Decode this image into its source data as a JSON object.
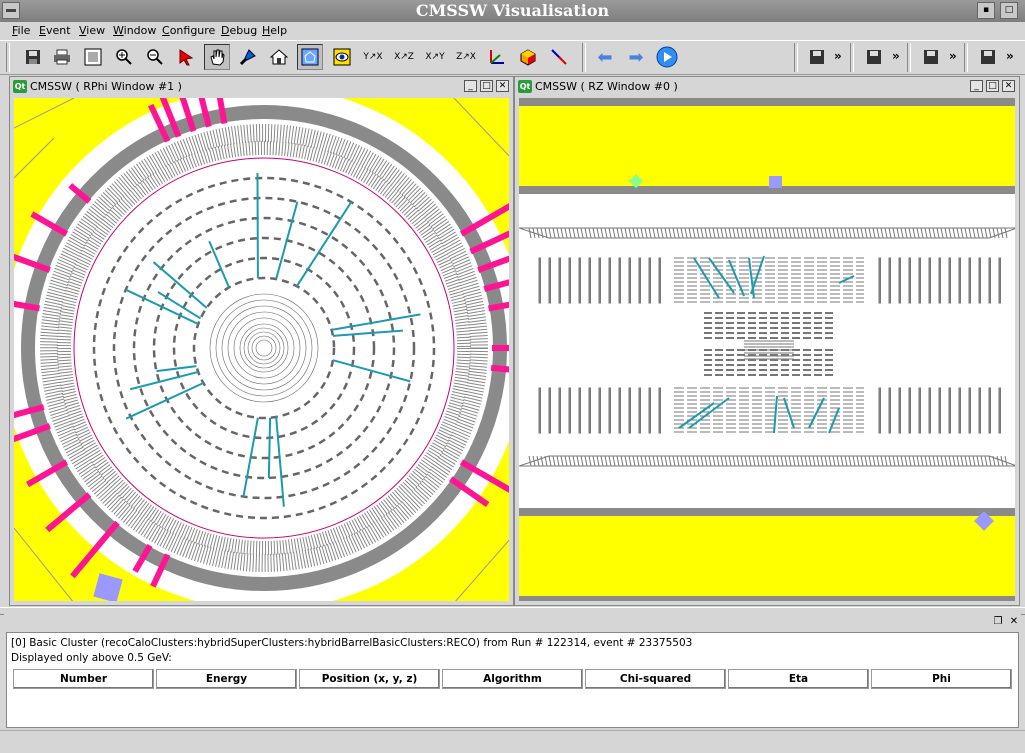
{
  "window": {
    "title": "CMSSW Visualisation"
  },
  "menu": [
    "File",
    "Event",
    "View",
    "Window",
    "Configure",
    "Debug",
    "Help"
  ],
  "toolbar": {
    "buttons": [
      "save-icon",
      "print-icon",
      "film-icon",
      "zoom-in-icon",
      "zoom-out-icon",
      "pointer-icon",
      "hand-icon",
      "flashlight-icon",
      "home-icon",
      "fit-view-icon",
      "eye-icon",
      "axes-yx-icon",
      "axes-xz-icon",
      "axes-xy-icon",
      "axes-zx-icon",
      "camera-icon",
      "axis-icon",
      "cube-icon",
      "arrows-icon",
      "prev-event-icon",
      "next-event-icon",
      "play-icon"
    ],
    "overflow": "»"
  },
  "rphi": {
    "title": "CMSSW ( RPhi Window #1 )",
    "badge": "Qt"
  },
  "rz": {
    "title": "CMSSW ( RZ Window #0 )",
    "badge": "Qt"
  },
  "colors": {
    "calo": "#ff1493",
    "track": "#1a9bb0",
    "yoke": "#ffff00",
    "muon": "#9999ff",
    "gray": "#8a8a8a"
  },
  "info": {
    "line1": "[0] Basic Cluster (recoCaloClusters:hybridSuperClusters:hybridBarrelBasicClusters:RECO) from Run # 122314, event # 23375503",
    "line2": "Displayed only above 0.5 GeV:",
    "columns": [
      "Number",
      "Energy",
      "Position (x, y, z)",
      "Algorithm",
      "Chi-squared",
      "Eta",
      "Phi"
    ]
  }
}
